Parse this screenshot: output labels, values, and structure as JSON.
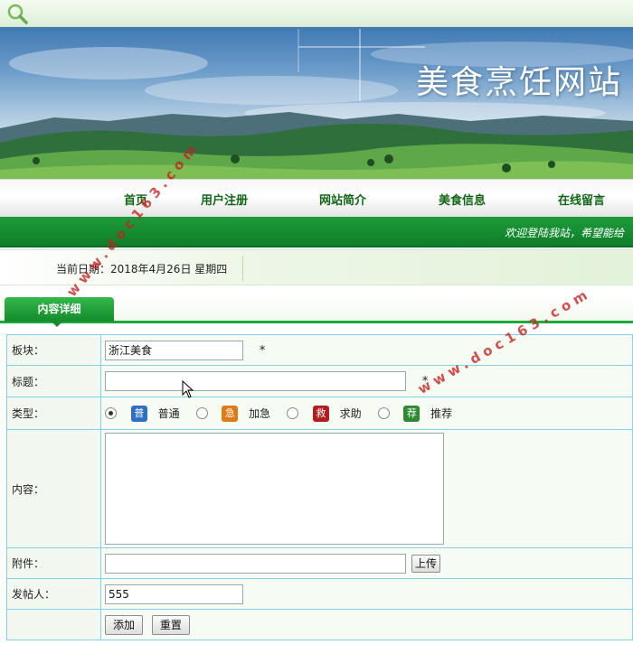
{
  "header": {
    "site_title": "美食烹饪网站"
  },
  "nav": {
    "items": [
      {
        "label": "首页"
      },
      {
        "label": "用户注册"
      },
      {
        "label": "网站简介"
      },
      {
        "label": "美食信息"
      },
      {
        "label": "在线留言"
      }
    ]
  },
  "welcome": {
    "text": "欢迎登陆我站，希望能给"
  },
  "datebar": {
    "text": "当前日期：2018年4月26日  星期四"
  },
  "section": {
    "tab_label": "内容详细"
  },
  "form": {
    "board": {
      "label": "板块：",
      "value": "浙江美食",
      "required_mark": "*"
    },
    "title": {
      "label": "标题：",
      "value": "",
      "required_mark": "*"
    },
    "type": {
      "label": "类型：",
      "selected": "普通",
      "options": [
        {
          "label": "普通",
          "tag": "普",
          "tag_color": "#2c6fc4",
          "icon": "blue-tag-icon"
        },
        {
          "label": "加急",
          "tag": "急",
          "tag_color": "#e07a12",
          "icon": "orange-tag-icon"
        },
        {
          "label": "求助",
          "tag": "救",
          "tag_color": "#b21e1e",
          "icon": "red-tag-icon"
        },
        {
          "label": "推荐",
          "tag": "荐",
          "tag_color": "#2f8a2f",
          "icon": "green-tag-icon"
        }
      ]
    },
    "content": {
      "label": "内容：",
      "value": ""
    },
    "attachment": {
      "label": "附件：",
      "value": "",
      "upload_label": "上传"
    },
    "poster": {
      "label": "发帖人：",
      "value": "555"
    },
    "buttons": {
      "add_label": "添加",
      "reset_label": "重置"
    }
  },
  "watermark": {
    "text": "www.doc163.com",
    "color": "#c81e1e"
  },
  "colors": {
    "nav_text": "#116616",
    "bar_green": "#138a2b",
    "table_border": "#7fd2e8"
  }
}
